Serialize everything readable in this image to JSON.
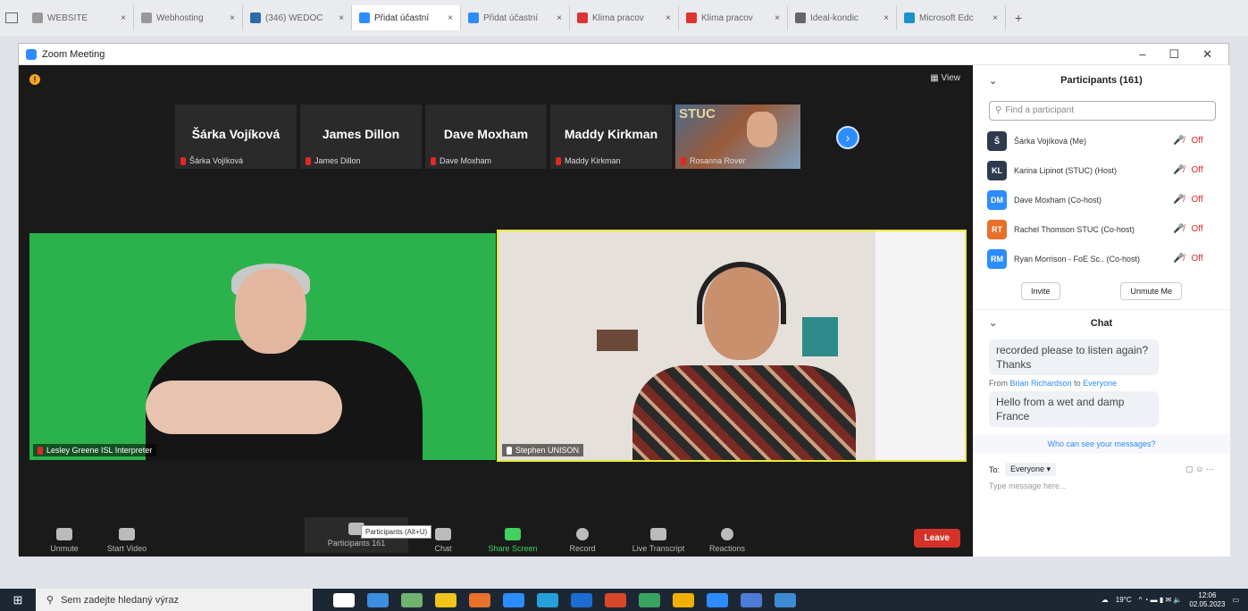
{
  "browser": {
    "tabs": [
      {
        "label": "WEBSITE",
        "color": "#999"
      },
      {
        "label": "Webhosting",
        "color": "#999"
      },
      {
        "label": "(346) WEDOC",
        "color": "#2d6aa8"
      },
      {
        "label": "Přidat účastní",
        "color": "#2d8cff"
      },
      {
        "label": "Přidat účastní",
        "color": "#2d8cff"
      },
      {
        "label": "Klima pracov",
        "color": "#d33"
      },
      {
        "label": "Klima pracov",
        "color": "#d33"
      },
      {
        "label": "Ideal-kondic",
        "color": "#666"
      },
      {
        "label": "Microsoft Edc",
        "color": "#1e90c8"
      }
    ],
    "new_tab": "+"
  },
  "window": {
    "title": "Zoom Meeting",
    "min": "–",
    "max": "☐",
    "close": "✕"
  },
  "meeting": {
    "view_label": "View",
    "next_page": "›",
    "strip": [
      {
        "name": "Šárka Vojíková",
        "label": "Šárka Vojíková"
      },
      {
        "name": "James Dillon",
        "label": "James Dillon"
      },
      {
        "name": "Dave Moxham",
        "label": "Dave Moxham"
      },
      {
        "name": "Maddy Kirkman",
        "label": "Maddy Kirkman"
      }
    ],
    "strip_video": {
      "label": "Rosanna Rover",
      "logo": "STUC"
    },
    "main_left": "Lesley Greene ISL Interpreter",
    "main_right": "Stephen UNISON",
    "toolbar": {
      "unmute": "Unmute",
      "start_video": "Start Video",
      "participants": "Participants",
      "participants_count": "161",
      "chat": "Chat",
      "share": "Share Screen",
      "record": "Record",
      "transcript": "Live Transcript",
      "reactions": "Reactions",
      "leave": "Leave",
      "tooltip": "Participants (Alt+U)"
    }
  },
  "participants": {
    "title": "Participants (161)",
    "search_placeholder": "Find a participant",
    "list": [
      {
        "initials": "Š",
        "name": "Šárka Vojíková (Me)",
        "color": "#2e3a4e"
      },
      {
        "initials": "KL",
        "name": "Karina Lipinot (STUC) (Host)",
        "color": "#2e3a4e"
      },
      {
        "initials": "DM",
        "name": "Dave Moxham (Co-host)",
        "color": "#2d8cff"
      },
      {
        "initials": "RT",
        "name": "Rachel Thomson STUC (Co-host)",
        "color": "#e8702a"
      },
      {
        "initials": "RM",
        "name": "Ryan Morrison - FoE Sc.. (Co-host)",
        "color": "#2d8cff"
      }
    ],
    "mic_icon": "🎤̸",
    "off_label": "Off",
    "invite": "Invite",
    "unmute_me": "Unmute Me"
  },
  "chat": {
    "title": "Chat",
    "msg1": "recorded please to listen again? Thanks",
    "from_prefix": "From",
    "from_name": "Brian Richardson",
    "to_word": "to",
    "to_name": "Everyone",
    "msg2": "Hello from a wet and damp France",
    "who_sees": "Who can see your messages?",
    "to_label": "To:",
    "to_select": "Everyone ▾",
    "placeholder": "Type message here..."
  },
  "taskbar": {
    "search": "Sem zadejte hledaný výraz",
    "weather": "19°C",
    "time": "12:06",
    "date": "02.05.2023",
    "apps": [
      "#ffffff",
      "#3c8ee0",
      "#6fb36f",
      "#f0c419",
      "#e8702a",
      "#2d8cff",
      "#25a0da",
      "#1c6cd1",
      "#d9472b",
      "#3aa35f",
      "#f0b000",
      "#2d8cff",
      "#4d7bd6",
      "#3d8bd1"
    ]
  }
}
